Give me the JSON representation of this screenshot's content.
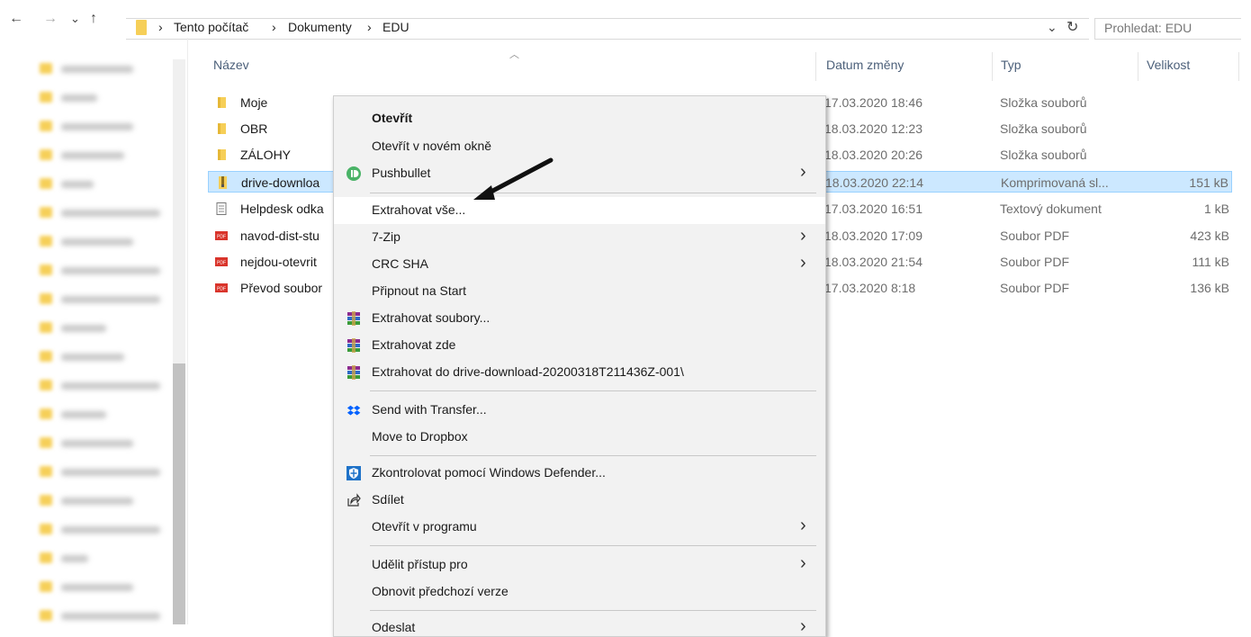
{
  "address": {
    "back": "←",
    "forward": "→",
    "history": "⌄",
    "up": "↑",
    "separator": "›",
    "crumbs": [
      "Tento počítač",
      "Dokumenty",
      "EDU"
    ],
    "dropdown": "⌄",
    "refresh": "↻",
    "search_placeholder": "Prohledat: EDU"
  },
  "columns": {
    "name": "Název",
    "date": "Datum změny",
    "type": "Typ",
    "size": "Velikost"
  },
  "files": [
    {
      "name": "Moje",
      "date": "17.03.2020 18:46",
      "type": "Složka souborů",
      "size": "",
      "icon": "folder-icon"
    },
    {
      "name": "OBR",
      "date": "18.03.2020 12:23",
      "type": "Složka souborů",
      "size": "",
      "icon": "folder-icon"
    },
    {
      "name": "ZÁLOHY",
      "date": "18.03.2020 20:26",
      "type": "Složka souborů",
      "size": "",
      "icon": "folder-icon"
    },
    {
      "name": "drive-downloa",
      "date": "18.03.2020 22:14",
      "type": "Komprimovaná sl...",
      "size": "151 kB",
      "icon": "zip-folder-icon"
    },
    {
      "name": "Helpdesk odka",
      "date": "17.03.2020 16:51",
      "type": "Textový dokument",
      "size": "1 kB",
      "icon": "text-file-icon"
    },
    {
      "name": "navod-dist-stu",
      "date": "18.03.2020 17:09",
      "type": "Soubor PDF",
      "size": "423 kB",
      "icon": "pdf-icon"
    },
    {
      "name": "nejdou-otevrit",
      "date": "18.03.2020 21:54",
      "type": "Soubor PDF",
      "size": "111 kB",
      "icon": "pdf-icon"
    },
    {
      "name": "Převod soubor",
      "date": "17.03.2020 8:18",
      "type": "Soubor PDF",
      "size": "136 kB",
      "icon": "pdf-icon"
    }
  ],
  "menu": {
    "open": "Otevřít",
    "open_new_window": "Otevřít v novém okně",
    "pushbullet": "Pushbullet",
    "extract_all": "Extrahovat vše...",
    "seven_zip": "7-Zip",
    "crc_sha": "CRC SHA",
    "pin_start": "Připnout na Start",
    "extract_files": "Extrahovat soubory...",
    "extract_here": "Extrahovat zde",
    "extract_to": "Extrahovat do drive-download-20200318T211436Z-001\\",
    "send_transfer": "Send with Transfer...",
    "move_dropbox": "Move to Dropbox",
    "defender": "Zkontrolovat pomocí Windows Defender...",
    "share": "Sdílet",
    "open_with": "Otevřít v programu",
    "grant_access": "Udělit přístup pro",
    "restore_versions": "Obnovit předchozí verze",
    "send_to": "Odeslat",
    "chevron": "›"
  },
  "colors": {
    "accent": "#cce8ff",
    "folder": "#f6cf58",
    "pdf": "#d9342b",
    "dropbox": "#0061ff",
    "pushbullet": "#4ab367"
  }
}
